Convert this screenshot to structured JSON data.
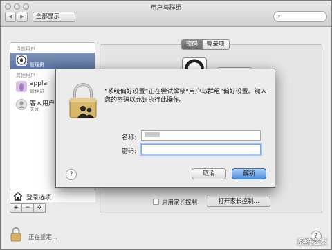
{
  "window": {
    "title": "用户与群组"
  },
  "toolbar": {
    "back": "◀",
    "forward": "▶",
    "show_all": "全部显示"
  },
  "sidebar": {
    "current_users_label": "当前用户",
    "current_user": {
      "role": "管理员"
    },
    "other_users_label": "其他用户",
    "others": [
      {
        "name": "apple",
        "role": "管理员"
      },
      {
        "name": "客人用户",
        "role": "关闭"
      }
    ],
    "login_options": "登录选项",
    "tools": [
      "+",
      "−",
      "✲"
    ]
  },
  "pane": {
    "tabs": [
      "密码",
      "登录项"
    ],
    "parental_checkbox": "启用家长控制",
    "open_parental": "打开家长控制..."
  },
  "status": {
    "text": "正在鉴定..."
  },
  "dialog": {
    "message": "“系统偏好设置”正在尝试解锁“用户与群组”偏好设置。键入您的密码以允许执行此操作。",
    "name_label": "名称:",
    "password_label": "密码:",
    "help": "?",
    "cancel": "取消",
    "unlock": "解锁"
  },
  "watermark": {
    "text": "系统之家",
    "sub": "XITONGZHIJIA.NET"
  }
}
